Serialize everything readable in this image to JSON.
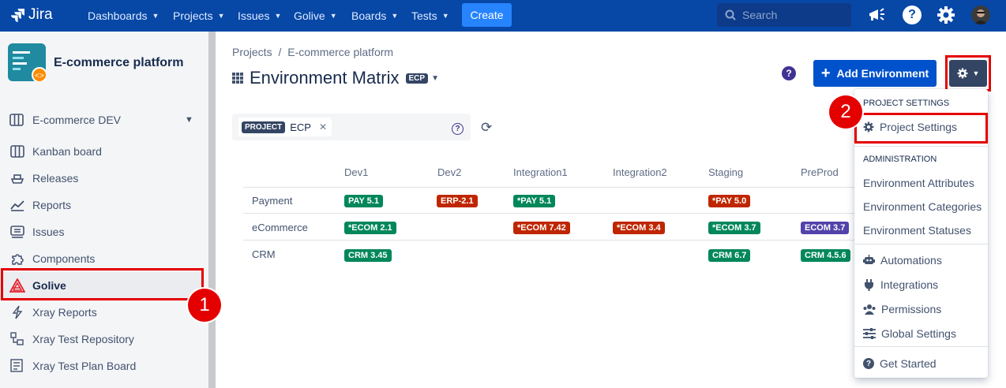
{
  "app": {
    "name": "Jira"
  },
  "topnav": {
    "items": [
      "Dashboards",
      "Projects",
      "Issues",
      "Golive",
      "Boards",
      "Tests"
    ],
    "create_label": "Create",
    "search_placeholder": "Search"
  },
  "sidebar": {
    "project_name": "E-commerce platform",
    "board_selector": "E-commerce DEV",
    "items": [
      {
        "label": "Kanban board",
        "icon": "kanban-icon"
      },
      {
        "label": "Releases",
        "icon": "ship-icon"
      },
      {
        "label": "Reports",
        "icon": "chart-line-icon"
      },
      {
        "label": "Issues",
        "icon": "issues-icon"
      },
      {
        "label": "Components",
        "icon": "puzzle-icon"
      },
      {
        "label": "Golive",
        "icon": "golive-icon"
      },
      {
        "label": "Xray Reports",
        "icon": "lightning-icon"
      },
      {
        "label": "Xray Test Repository",
        "icon": "repository-icon"
      },
      {
        "label": "Xray Test Plan Board",
        "icon": "plan-board-icon"
      }
    ]
  },
  "annotations": {
    "step1": "1",
    "step2": "2"
  },
  "breadcrumb": {
    "projects": "Projects",
    "sep": "/",
    "project": "E-commerce platform"
  },
  "page": {
    "title": "Environment Matrix",
    "project_key": "ECP"
  },
  "actions": {
    "add_environment": "Add Environment"
  },
  "filter": {
    "chip_label": "PROJECT",
    "chip_value": "ECP"
  },
  "matrix": {
    "columns": [
      "Dev1",
      "Dev2",
      "Integration1",
      "Integration2",
      "Staging",
      "PreProd"
    ],
    "rows": [
      {
        "label": "Payment",
        "cells": [
          {
            "text": "PAY 5.1",
            "color": "green"
          },
          {
            "text": "ERP-2.1",
            "color": "red"
          },
          {
            "text": "*PAY 5.1",
            "color": "green"
          },
          null,
          {
            "text": "*PAY 5.0",
            "color": "red"
          },
          null
        ]
      },
      {
        "label": "eCommerce",
        "cells": [
          {
            "text": "*ECOM 2.1",
            "color": "green"
          },
          null,
          {
            "text": "*ECOM 7.42",
            "color": "red"
          },
          {
            "text": "*ECOM 3.4",
            "color": "red"
          },
          {
            "text": "*ECOM 3.7",
            "color": "green"
          },
          {
            "text": "ECOM 3.7",
            "color": "purple"
          }
        ]
      },
      {
        "label": "CRM",
        "cells": [
          {
            "text": "CRM 3.45",
            "color": "green"
          },
          null,
          null,
          null,
          {
            "text": "CRM 6.7",
            "color": "green"
          },
          {
            "text": "CRM 4.5.6",
            "color": "green"
          }
        ]
      }
    ]
  },
  "dropdown": {
    "project_settings_header": "PROJECT SETTINGS",
    "project_settings": "Project Settings",
    "administration_header": "ADMINISTRATION",
    "env_attributes": "Environment Attributes",
    "env_categories": "Environment Categories",
    "env_statuses": "Environment Statuses",
    "automations": "Automations",
    "integrations": "Integrations",
    "permissions": "Permissions",
    "global_settings": "Global Settings",
    "get_started": "Get Started"
  },
  "colors": {
    "topbar": "#0747a6",
    "primary": "#0052cc",
    "green": "#00875a",
    "red": "#bf2600",
    "purple": "#5243aa",
    "highlight": "#e50000"
  }
}
